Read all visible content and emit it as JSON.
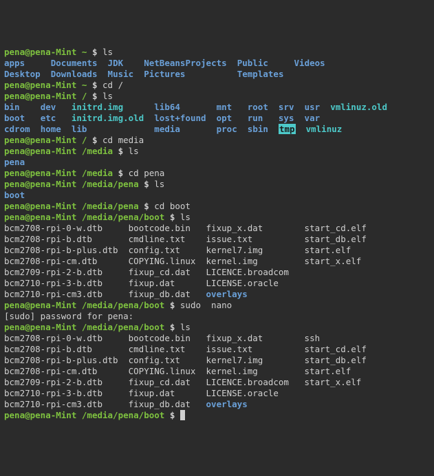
{
  "user": "pena",
  "host": "pena-Mint",
  "prompt_sym": "$",
  "lines": [
    {
      "t": "prompt",
      "path": "~",
      "cmd": "ls"
    },
    {
      "t": "cols",
      "cols": [
        {
          "txt": "apps",
          "cls": "dir"
        },
        {
          "txt": "Documents",
          "cls": "dir"
        },
        {
          "txt": "JDK",
          "cls": "dir"
        },
        {
          "txt": "NetBeansProjects",
          "cls": "dir"
        },
        {
          "txt": "Public",
          "cls": "dir"
        },
        {
          "txt": "Videos",
          "cls": "dir"
        }
      ],
      "widths": [
        9,
        11,
        7,
        18,
        11,
        0
      ]
    },
    {
      "t": "cols",
      "cols": [
        {
          "txt": "Desktop",
          "cls": "dir"
        },
        {
          "txt": "Downloads",
          "cls": "dir"
        },
        {
          "txt": "Music",
          "cls": "dir"
        },
        {
          "txt": "Pictures",
          "cls": "dir"
        },
        {
          "txt": "Templates",
          "cls": "dir"
        }
      ],
      "widths": [
        9,
        11,
        7,
        18,
        11
      ]
    },
    {
      "t": "prompt",
      "path": "~",
      "cmd": "cd /"
    },
    {
      "t": "prompt",
      "path": "/",
      "cmd": "ls"
    },
    {
      "t": "cols",
      "cols": [
        {
          "txt": "bin",
          "cls": "dir"
        },
        {
          "txt": "dev",
          "cls": "dir"
        },
        {
          "txt": "initrd.img",
          "cls": "ln"
        },
        {
          "txt": "lib64",
          "cls": "dir"
        },
        {
          "txt": "mnt",
          "cls": "dir"
        },
        {
          "txt": "root",
          "cls": "dir"
        },
        {
          "txt": "srv",
          "cls": "dir"
        },
        {
          "txt": "usr",
          "cls": "dir"
        },
        {
          "txt": "vmlinuz.old",
          "cls": "ln"
        }
      ],
      "widths": [
        7,
        6,
        16,
        12,
        6,
        6,
        5,
        5,
        0
      ]
    },
    {
      "t": "cols",
      "cols": [
        {
          "txt": "boot",
          "cls": "dir"
        },
        {
          "txt": "etc",
          "cls": "dir"
        },
        {
          "txt": "initrd.img.old",
          "cls": "ln"
        },
        {
          "txt": "lost+found",
          "cls": "dir"
        },
        {
          "txt": "opt",
          "cls": "dir"
        },
        {
          "txt": "run",
          "cls": "dir"
        },
        {
          "txt": "sys",
          "cls": "dir"
        },
        {
          "txt": "var",
          "cls": "dir"
        }
      ],
      "widths": [
        7,
        6,
        16,
        12,
        6,
        6,
        5,
        5
      ]
    },
    {
      "t": "cols",
      "cols": [
        {
          "txt": "cdrom",
          "cls": "dir"
        },
        {
          "txt": "home",
          "cls": "dir"
        },
        {
          "txt": "lib",
          "cls": "dir"
        },
        {
          "txt": "media",
          "cls": "dir"
        },
        {
          "txt": "proc",
          "cls": "dir"
        },
        {
          "txt": "sbin",
          "cls": "dir"
        },
        {
          "txt": "tmp",
          "cls": "hl"
        },
        {
          "txt": "vmlinuz",
          "cls": "ln"
        }
      ],
      "widths": [
        7,
        6,
        16,
        12,
        6,
        6,
        5,
        0
      ]
    },
    {
      "t": "prompt",
      "path": "/",
      "cmd": "cd media"
    },
    {
      "t": "prompt",
      "path": "/media",
      "cmd": "ls"
    },
    {
      "t": "cols",
      "cols": [
        {
          "txt": "pena",
          "cls": "dir"
        }
      ],
      "widths": [
        0
      ]
    },
    {
      "t": "prompt",
      "path": "/media",
      "cmd": "cd pena"
    },
    {
      "t": "prompt",
      "path": "/media/pena",
      "cmd": "ls"
    },
    {
      "t": "cols",
      "cols": [
        {
          "txt": "boot",
          "cls": "dir"
        }
      ],
      "widths": [
        0
      ]
    },
    {
      "t": "prompt",
      "path": "/media/pena",
      "cmd": "cd boot"
    },
    {
      "t": "prompt",
      "path": "/media/pena/boot",
      "cmd": "ls"
    },
    {
      "t": "cols",
      "cols": [
        {
          "txt": "bcm2708-rpi-0-w.dtb",
          "cls": "file"
        },
        {
          "txt": "bootcode.bin",
          "cls": "file"
        },
        {
          "txt": "fixup_x.dat",
          "cls": "file"
        },
        {
          "txt": "start_cd.elf",
          "cls": "file"
        }
      ],
      "widths": [
        24,
        15,
        19,
        0
      ]
    },
    {
      "t": "cols",
      "cols": [
        {
          "txt": "bcm2708-rpi-b.dtb",
          "cls": "file"
        },
        {
          "txt": "cmdline.txt",
          "cls": "file"
        },
        {
          "txt": "issue.txt",
          "cls": "file"
        },
        {
          "txt": "start_db.elf",
          "cls": "file"
        }
      ],
      "widths": [
        24,
        15,
        19,
        0
      ]
    },
    {
      "t": "cols",
      "cols": [
        {
          "txt": "bcm2708-rpi-b-plus.dtb",
          "cls": "file"
        },
        {
          "txt": "config.txt",
          "cls": "file"
        },
        {
          "txt": "kernel7.img",
          "cls": "file"
        },
        {
          "txt": "start.elf",
          "cls": "file"
        }
      ],
      "widths": [
        24,
        15,
        19,
        0
      ]
    },
    {
      "t": "cols",
      "cols": [
        {
          "txt": "bcm2708-rpi-cm.dtb",
          "cls": "file"
        },
        {
          "txt": "COPYING.linux",
          "cls": "file"
        },
        {
          "txt": "kernel.img",
          "cls": "file"
        },
        {
          "txt": "start_x.elf",
          "cls": "file"
        }
      ],
      "widths": [
        24,
        15,
        19,
        0
      ]
    },
    {
      "t": "cols",
      "cols": [
        {
          "txt": "bcm2709-rpi-2-b.dtb",
          "cls": "file"
        },
        {
          "txt": "fixup_cd.dat",
          "cls": "file"
        },
        {
          "txt": "LICENCE.broadcom",
          "cls": "file"
        }
      ],
      "widths": [
        24,
        15,
        0
      ]
    },
    {
      "t": "cols",
      "cols": [
        {
          "txt": "bcm2710-rpi-3-b.dtb",
          "cls": "file"
        },
        {
          "txt": "fixup.dat",
          "cls": "file"
        },
        {
          "txt": "LICENSE.oracle",
          "cls": "file"
        }
      ],
      "widths": [
        24,
        15,
        0
      ]
    },
    {
      "t": "cols",
      "cols": [
        {
          "txt": "bcm2710-rpi-cm3.dtb",
          "cls": "file"
        },
        {
          "txt": "fixup_db.dat",
          "cls": "file"
        },
        {
          "txt": "overlays",
          "cls": "dir"
        }
      ],
      "widths": [
        24,
        15,
        0
      ]
    },
    {
      "t": "prompt",
      "path": "/media/pena/boot",
      "cmd": "sudo  nano"
    },
    {
      "t": "plain",
      "txt": "[sudo] password for pena: "
    },
    {
      "t": "prompt",
      "path": "/media/pena/boot",
      "cmd": "ls"
    },
    {
      "t": "cols",
      "cols": [
        {
          "txt": "bcm2708-rpi-0-w.dtb",
          "cls": "file"
        },
        {
          "txt": "bootcode.bin",
          "cls": "file"
        },
        {
          "txt": "fixup_x.dat",
          "cls": "file"
        },
        {
          "txt": "ssh",
          "cls": "file"
        }
      ],
      "widths": [
        24,
        15,
        19,
        0
      ]
    },
    {
      "t": "cols",
      "cols": [
        {
          "txt": "bcm2708-rpi-b.dtb",
          "cls": "file"
        },
        {
          "txt": "cmdline.txt",
          "cls": "file"
        },
        {
          "txt": "issue.txt",
          "cls": "file"
        },
        {
          "txt": "start_cd.elf",
          "cls": "file"
        }
      ],
      "widths": [
        24,
        15,
        19,
        0
      ]
    },
    {
      "t": "cols",
      "cols": [
        {
          "txt": "bcm2708-rpi-b-plus.dtb",
          "cls": "file"
        },
        {
          "txt": "config.txt",
          "cls": "file"
        },
        {
          "txt": "kernel7.img",
          "cls": "file"
        },
        {
          "txt": "start_db.elf",
          "cls": "file"
        }
      ],
      "widths": [
        24,
        15,
        19,
        0
      ]
    },
    {
      "t": "cols",
      "cols": [
        {
          "txt": "bcm2708-rpi-cm.dtb",
          "cls": "file"
        },
        {
          "txt": "COPYING.linux",
          "cls": "file"
        },
        {
          "txt": "kernel.img",
          "cls": "file"
        },
        {
          "txt": "start.elf",
          "cls": "file"
        }
      ],
      "widths": [
        24,
        15,
        19,
        0
      ]
    },
    {
      "t": "cols",
      "cols": [
        {
          "txt": "bcm2709-rpi-2-b.dtb",
          "cls": "file"
        },
        {
          "txt": "fixup_cd.dat",
          "cls": "file"
        },
        {
          "txt": "LICENCE.broadcom",
          "cls": "file"
        },
        {
          "txt": "start_x.elf",
          "cls": "file"
        }
      ],
      "widths": [
        24,
        15,
        19,
        0
      ]
    },
    {
      "t": "cols",
      "cols": [
        {
          "txt": "bcm2710-rpi-3-b.dtb",
          "cls": "file"
        },
        {
          "txt": "fixup.dat",
          "cls": "file"
        },
        {
          "txt": "LICENSE.oracle",
          "cls": "file"
        }
      ],
      "widths": [
        24,
        15,
        0
      ]
    },
    {
      "t": "cols",
      "cols": [
        {
          "txt": "bcm2710-rpi-cm3.dtb",
          "cls": "file"
        },
        {
          "txt": "fixup_db.dat",
          "cls": "file"
        },
        {
          "txt": "overlays",
          "cls": "dir"
        }
      ],
      "widths": [
        24,
        15,
        0
      ]
    },
    {
      "t": "prompt",
      "path": "/media/pena/boot",
      "cmd": "",
      "cursor": true
    }
  ]
}
